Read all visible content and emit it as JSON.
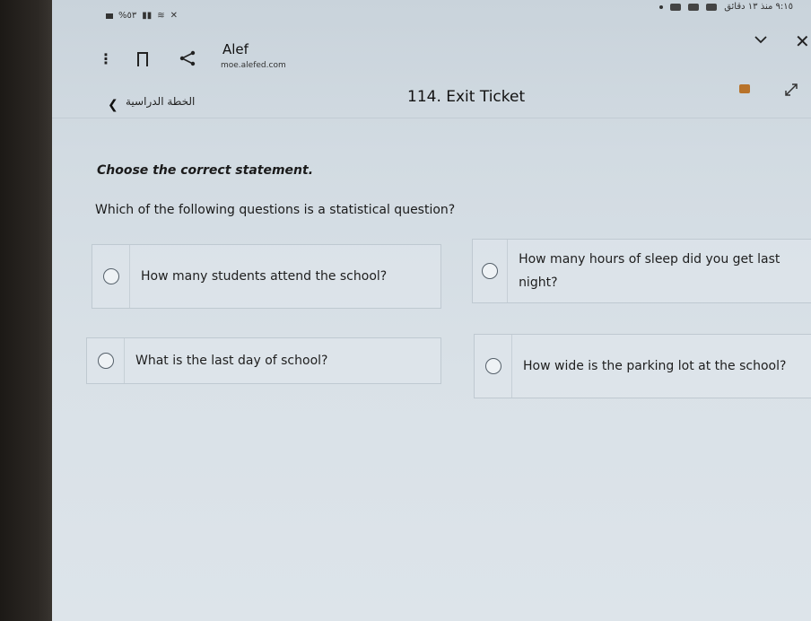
{
  "status_bar": {
    "left_text": "%٥٣",
    "right_text": "٩:١٥  منذ ١٣ دقائق"
  },
  "app_header": {
    "title": "Alef",
    "url": "moe.alefed.com"
  },
  "nav": {
    "back_label": "الخطة الدراسية",
    "page_title": "114. Exit Ticket"
  },
  "content": {
    "instruction": "Choose the correct statement.",
    "question": "Which of the following questions is a statistical question?",
    "options": [
      {
        "label": "How many students attend the school?"
      },
      {
        "label": "How many hours of sleep did you get last night?"
      },
      {
        "label": "What is the last day of school?"
      },
      {
        "label": "How wide is the parking lot at the school?"
      }
    ]
  },
  "colors": {
    "screen_bg": "#d2dbe2",
    "border": "#bfc9d1",
    "badge": "#b8732a"
  },
  "icons": [
    "menu-icon",
    "bookmark-icon",
    "share-icon",
    "chevron-down-icon",
    "close-icon",
    "back-chevron-icon",
    "badge-icon",
    "expand-icon"
  ]
}
